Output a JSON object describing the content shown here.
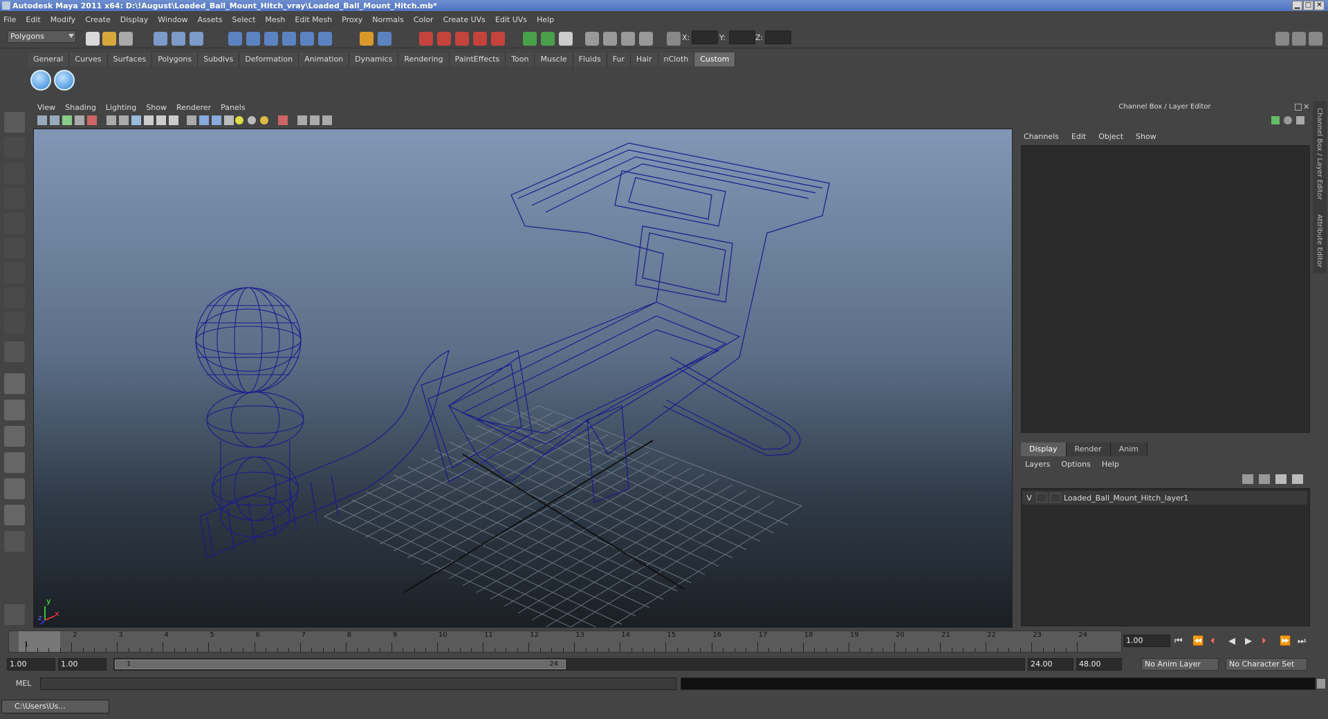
{
  "window": {
    "title": "Autodesk Maya 2011 x64: D:\\!August\\Loaded_Ball_Mount_Hitch_vray\\Loaded_Ball_Mount_Hitch.mb*",
    "min_glyph": "▁",
    "max_glyph": "□",
    "close_glyph": "✕"
  },
  "menubar": [
    "File",
    "Edit",
    "Modify",
    "Create",
    "Display",
    "Window",
    "Assets",
    "Select",
    "Mesh",
    "Edit Mesh",
    "Proxy",
    "Normals",
    "Color",
    "Create UVs",
    "Edit UVs",
    "Help"
  ],
  "status_line": {
    "mode": "Polygons",
    "x_label": "X:",
    "y_label": "Y:",
    "z_label": "Z:"
  },
  "shelf": {
    "tabs": [
      "General",
      "Curves",
      "Surfaces",
      "Polygons",
      "Subdivs",
      "Deformation",
      "Animation",
      "Dynamics",
      "Rendering",
      "PaintEffects",
      "Toon",
      "Muscle",
      "Fluids",
      "Fur",
      "Hair",
      "nCloth",
      "Custom"
    ],
    "active_tab": "Custom"
  },
  "viewport": {
    "menu": [
      "View",
      "Shading",
      "Lighting",
      "Show",
      "Renderer",
      "Panels"
    ],
    "axis_y": "y",
    "axis_x": "x",
    "axis_z": "z",
    "wire_color": "#1a1a8c"
  },
  "channel_box": {
    "header": "Channel Box / Layer Editor",
    "menu": [
      "Channels",
      "Edit",
      "Object",
      "Show"
    ]
  },
  "layer_editor": {
    "tabs": [
      "Display",
      "Render",
      "Anim"
    ],
    "active_tab": "Display",
    "menu": [
      "Layers",
      "Options",
      "Help"
    ],
    "layer": {
      "visible": "V",
      "name": "Loaded_Ball_Mount_Hitch_layer1"
    }
  },
  "side_tabs": [
    "Channel Box / Layer Editor",
    "Attribute Editor"
  ],
  "timeslider": {
    "frames": [
      "1",
      "2",
      "3",
      "4",
      "5",
      "6",
      "7",
      "8",
      "9",
      "10",
      "11",
      "12",
      "13",
      "14",
      "15",
      "16",
      "17",
      "18",
      "19",
      "20",
      "21",
      "22",
      "23",
      "24"
    ],
    "current_frame": "1",
    "current_time": "1.00"
  },
  "range_slider": {
    "start_time": "1.00",
    "playback_start": "1.00",
    "range_start": "1",
    "range_end": "24",
    "playback_end": "24.00",
    "end_time": "48.00",
    "anim_layer": "No Anim Layer",
    "character_set": "No Character Set"
  },
  "command_line": {
    "label": "MEL"
  },
  "taskbar": {
    "item": "C:\\Users\\Us..."
  }
}
